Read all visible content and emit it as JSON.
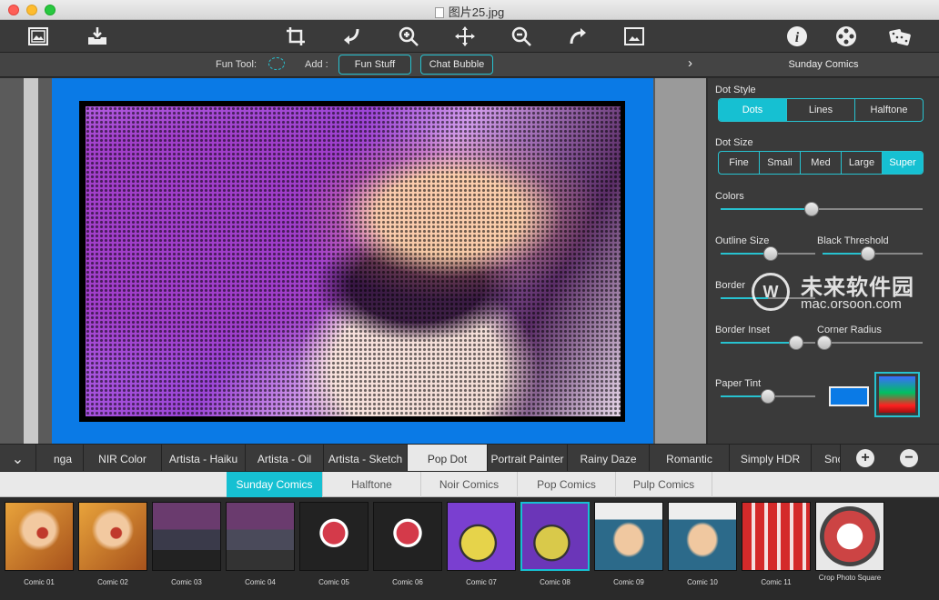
{
  "window": {
    "title": "图片25.jpg"
  },
  "toolbar": {
    "buttons": [
      "open-image",
      "export",
      "crop",
      "rotate-left",
      "zoom-in",
      "move",
      "zoom-out",
      "rotate-right",
      "fit-image",
      "info",
      "settings",
      "random"
    ]
  },
  "subbar": {
    "fun_tool_label": "Fun Tool:",
    "add_label": "Add :",
    "fun_stuff": "Fun Stuff",
    "chat_bubble": "Chat Bubble",
    "panel_title": "Sunday Comics",
    "chevron": "›"
  },
  "panel": {
    "dot_style": {
      "label": "Dot Style",
      "options": [
        "Dots",
        "Lines",
        "Halftone"
      ],
      "selected": "Dots"
    },
    "dot_size": {
      "label": "Dot Size",
      "options": [
        "Fine",
        "Small",
        "Med",
        "Large",
        "Super"
      ],
      "selected": "Super"
    },
    "colors": {
      "label": "Colors",
      "value": 0.45
    },
    "outline_size": {
      "label": "Outline Size",
      "value": 0.53
    },
    "black_threshold": {
      "label": "Black Threshold",
      "value": 0.45
    },
    "border": {
      "label": "Border",
      "value": 0.5
    },
    "border_inset": {
      "label": "Border Inset",
      "value": 0.8
    },
    "corner_radius": {
      "label": "Corner Radius",
      "value": 0.02
    },
    "paper_tint": {
      "label": "Paper Tint",
      "value": 0.5,
      "color": "#0a7ae6"
    },
    "watermark": {
      "logo": "W",
      "name": "未来软件园",
      "url": "mac.orsoon.com"
    }
  },
  "categories": {
    "tabs": [
      "nga",
      "NIR Color",
      "Artista - Haiku",
      "Artista - Oil",
      "Artista - Sketch",
      "Pop Dot",
      "Portrait Painter",
      "Rainy Daze",
      "Romantic",
      "Simply HDR",
      "Snc"
    ],
    "active": "Pop Dot",
    "collapse_icon": "chevron-down",
    "add": "+",
    "remove": "−"
  },
  "subtabs": {
    "items": [
      "Sunday Comics",
      "Halftone",
      "Noir Comics",
      "Pop Comics",
      "Pulp Comics"
    ],
    "active": "Sunday Comics"
  },
  "presets": [
    {
      "label": "Comic 01"
    },
    {
      "label": "Comic 02"
    },
    {
      "label": "Comic 03"
    },
    {
      "label": "Comic 04"
    },
    {
      "label": "Comic 05"
    },
    {
      "label": "Comic 06"
    },
    {
      "label": "Comic 07"
    },
    {
      "label": "Comic 08"
    },
    {
      "label": "Comic 09"
    },
    {
      "label": "Comic 10"
    },
    {
      "label": "Comic 11"
    },
    {
      "label": "Crop Photo Square"
    }
  ],
  "selected_preset": "Comic 08",
  "colors": {
    "accent": "#16c0d2",
    "paper": "#0a7ae6"
  }
}
